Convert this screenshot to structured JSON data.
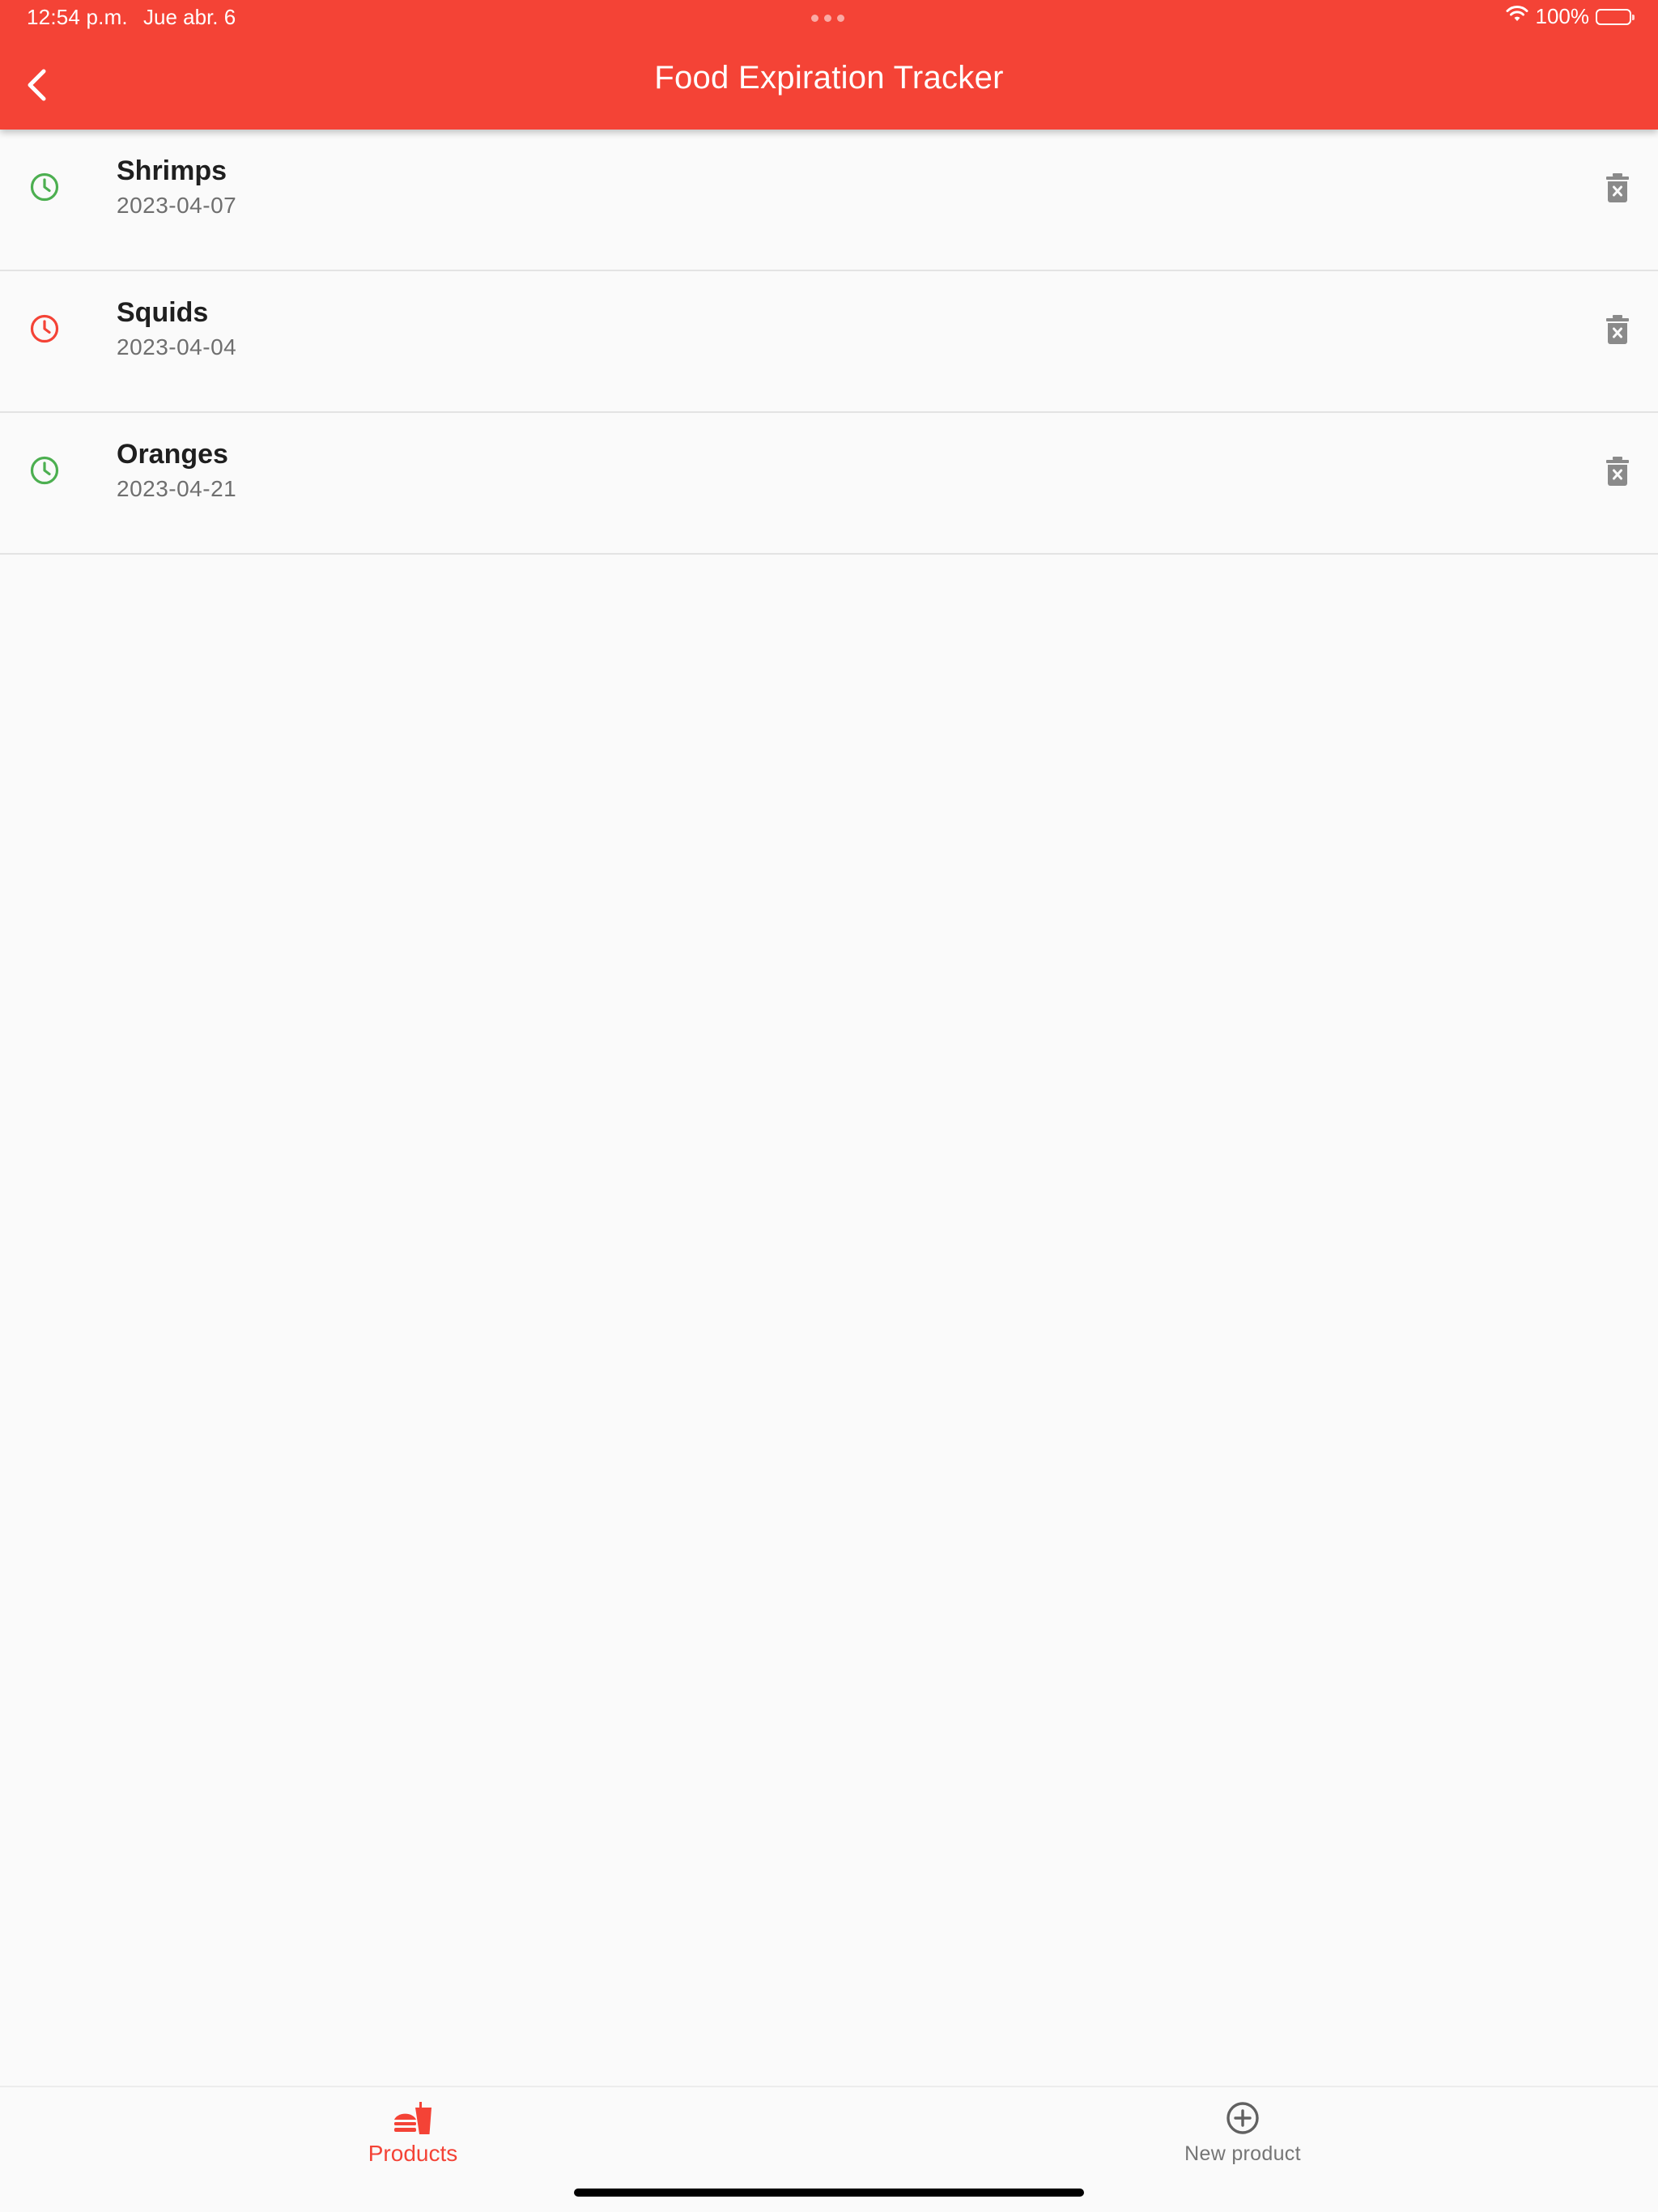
{
  "status_bar": {
    "time": "12:54 p.m.",
    "date": "Jue abr. 6",
    "battery": "100%",
    "battery_level": 1.0
  },
  "app_bar": {
    "title": "Food Expiration Tracker",
    "back_icon": "chevron-left-icon"
  },
  "products": [
    {
      "name": "Shrimps",
      "date": "2023-04-07",
      "status": "fresh",
      "status_color": "#4caf50",
      "status_icon": "clock-icon",
      "delete_icon": "trash-x-icon"
    },
    {
      "name": "Squids",
      "date": "2023-04-04",
      "status": "expired",
      "status_color": "#f44336",
      "status_icon": "clock-icon",
      "delete_icon": "trash-x-icon"
    },
    {
      "name": "Oranges",
      "date": "2023-04-21",
      "status": "fresh",
      "status_color": "#4caf50",
      "status_icon": "clock-icon",
      "delete_icon": "trash-x-icon"
    }
  ],
  "bottom_nav": {
    "items": [
      {
        "label": "Products",
        "icon": "fastfood-icon",
        "active": true
      },
      {
        "label": "New product",
        "icon": "add-circle-icon",
        "active": false
      }
    ]
  },
  "colors": {
    "accent": "#f44336",
    "fresh": "#4caf50",
    "expired": "#f44336",
    "icon_grey": "#8a8a8a",
    "background": "#fafafa"
  }
}
